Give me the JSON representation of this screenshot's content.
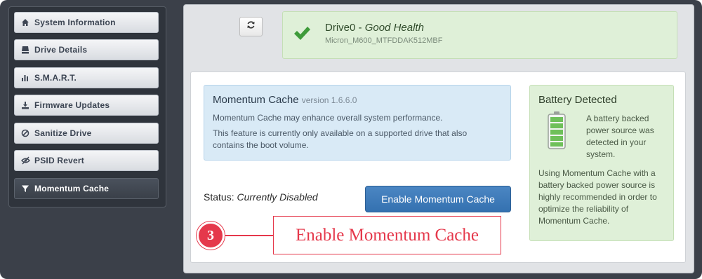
{
  "sidebar": {
    "items": [
      {
        "label": "System Information",
        "icon": "home-icon"
      },
      {
        "label": "Drive Details",
        "icon": "drive-icon"
      },
      {
        "label": "S.M.A.R.T.",
        "icon": "bar-chart-icon"
      },
      {
        "label": "Firmware Updates",
        "icon": "download-icon"
      },
      {
        "label": "Sanitize Drive",
        "icon": "ban-icon"
      },
      {
        "label": "PSID Revert",
        "icon": "eye-slash-icon"
      },
      {
        "label": "Momentum Cache",
        "icon": "filter-icon",
        "active": true
      }
    ]
  },
  "drive": {
    "name": "Drive0",
    "separator": " - ",
    "health": "Good Health",
    "model": "Micron_M600_MTFDDAK512MBF"
  },
  "momentum": {
    "title": "Momentum Cache",
    "version": "version 1.6.6.0",
    "desc1": "Momentum Cache may enhance overall system performance.",
    "desc2": "This feature is currently only available on a supported drive that also contains the boot volume."
  },
  "status": {
    "label": "Status:",
    "value": "Currently Disabled"
  },
  "enable_button": "Enable Momentum Cache",
  "battery": {
    "title": "Battery Detected",
    "desc": "A battery backed power source was detected in your system.",
    "note": "Using Momentum Cache with a battery backed power source is highly recommended in order to optimize the reliability of Momentum Cache."
  },
  "callout": {
    "number": "3",
    "text": "Enable Momentum Cache"
  },
  "colors": {
    "accent_blue": "#3a77b7",
    "success_green": "#3e9b3a",
    "callout_red": "#e5384b"
  }
}
